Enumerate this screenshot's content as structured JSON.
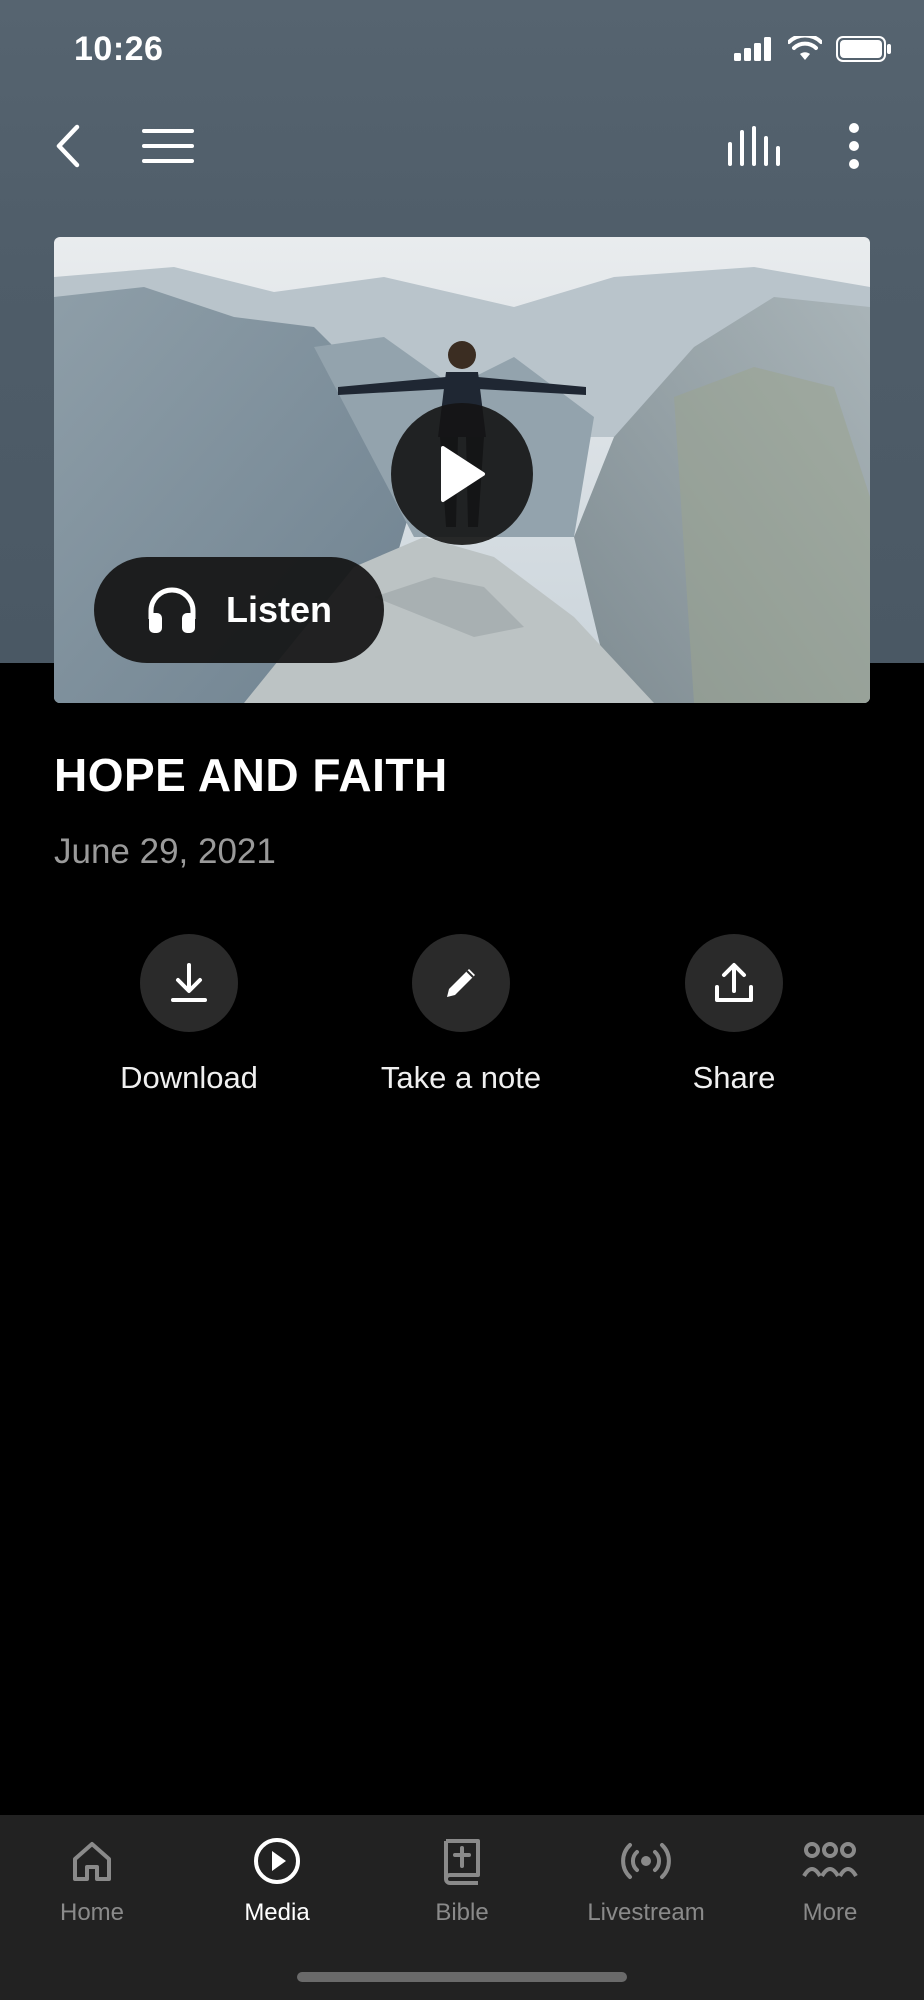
{
  "status_bar": {
    "time": "10:26"
  },
  "nav": {
    "back_icon": "chevron-left-icon",
    "menu_icon": "hamburger-icon",
    "audio_icon": "audio-bars-icon",
    "more_icon": "vertical-dots-icon"
  },
  "media": {
    "image_description_icon": "mountain-photo",
    "play_icon": "play-icon",
    "listen_label": "Listen",
    "listen_icon": "headphones-icon"
  },
  "sermon": {
    "title": "HOPE AND FAITH",
    "date": "June 29, 2021"
  },
  "actions": [
    {
      "label": "Download",
      "icon": "download-icon"
    },
    {
      "label": "Take a note",
      "icon": "pencil-icon"
    },
    {
      "label": "Share",
      "icon": "share-icon"
    }
  ],
  "tabbar": {
    "active": "Media",
    "tabs": [
      {
        "label": "Home",
        "icon": "home-icon"
      },
      {
        "label": "Media",
        "icon": "play-circle-icon"
      },
      {
        "label": "Bible",
        "icon": "bible-icon"
      },
      {
        "label": "Livestream",
        "icon": "broadcast-icon"
      },
      {
        "label": "More",
        "icon": "group-icon"
      }
    ]
  },
  "colors": {
    "header_bg": "#4f5d69",
    "page_bg": "#000000",
    "tabbar_bg": "#222222",
    "inactive_tab": "#8a8a8a"
  }
}
